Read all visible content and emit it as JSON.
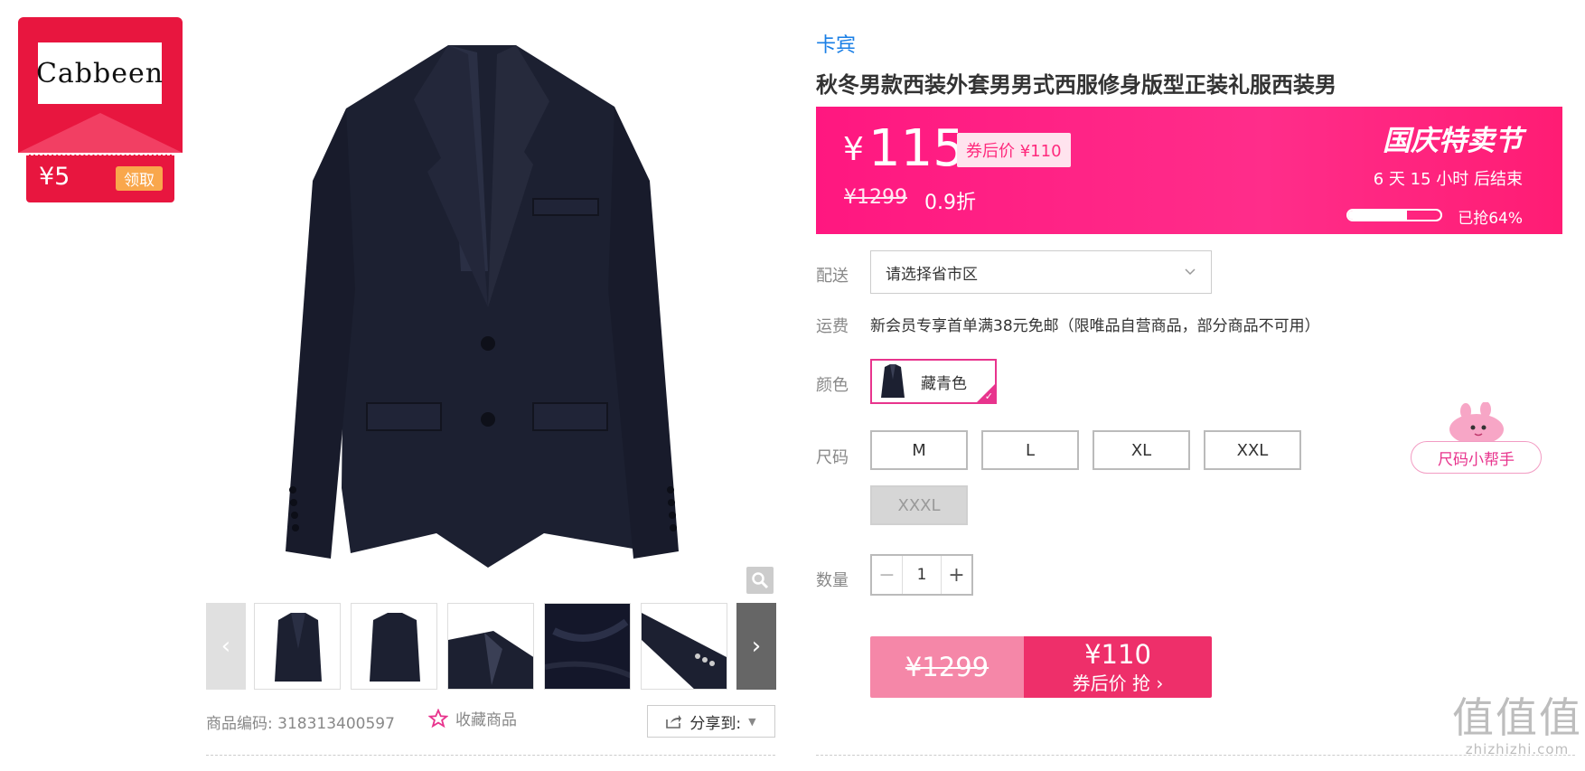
{
  "coupon": {
    "brand_logo_text": "Cabbeen",
    "amount": "¥5",
    "claim_label": "领取"
  },
  "gallery": {
    "prev_icon": "chevron-left-icon",
    "next_icon": "chevron-right-icon",
    "zoom_icon": "magnifier-icon"
  },
  "product": {
    "brand": "卡宾",
    "title": "秋冬男款西装外套男男式西服修身版型正装礼服西装男",
    "sku_label": "商品编码:",
    "sku_value": "318313400597",
    "favorite_label": "收藏商品",
    "share_label": "分享到:"
  },
  "promo": {
    "currency": "¥",
    "price": "115",
    "coupon_price": "券后价 ¥110",
    "original_price": "¥1299",
    "discount": "0.9折",
    "festival": "国庆特卖节",
    "countdown": "6  天 15 小时 后结束",
    "sold_percent": 64,
    "sold_label": "已抢64%"
  },
  "options": {
    "shipping_label": "配送",
    "region_placeholder": "请选择省市区",
    "fee_label": "运费",
    "fee_text": "新会员专享首单满38元免邮（限唯品自营商品，部分商品不可用）",
    "color_label": "颜色",
    "color_selected": "藏青色",
    "size_label": "尺码",
    "sizes": [
      "M",
      "L",
      "XL",
      "XXL",
      "XXXL"
    ],
    "size_helper": "尺码小帮手",
    "qty_label": "数量",
    "qty_minus": "−",
    "qty_value": "1",
    "qty_plus": "+"
  },
  "buy": {
    "original": "¥1299",
    "price": "¥110",
    "action": "券后价 抢 ›"
  },
  "watermark": {
    "big": "值值值",
    "small": "zhizhizhi.com"
  }
}
